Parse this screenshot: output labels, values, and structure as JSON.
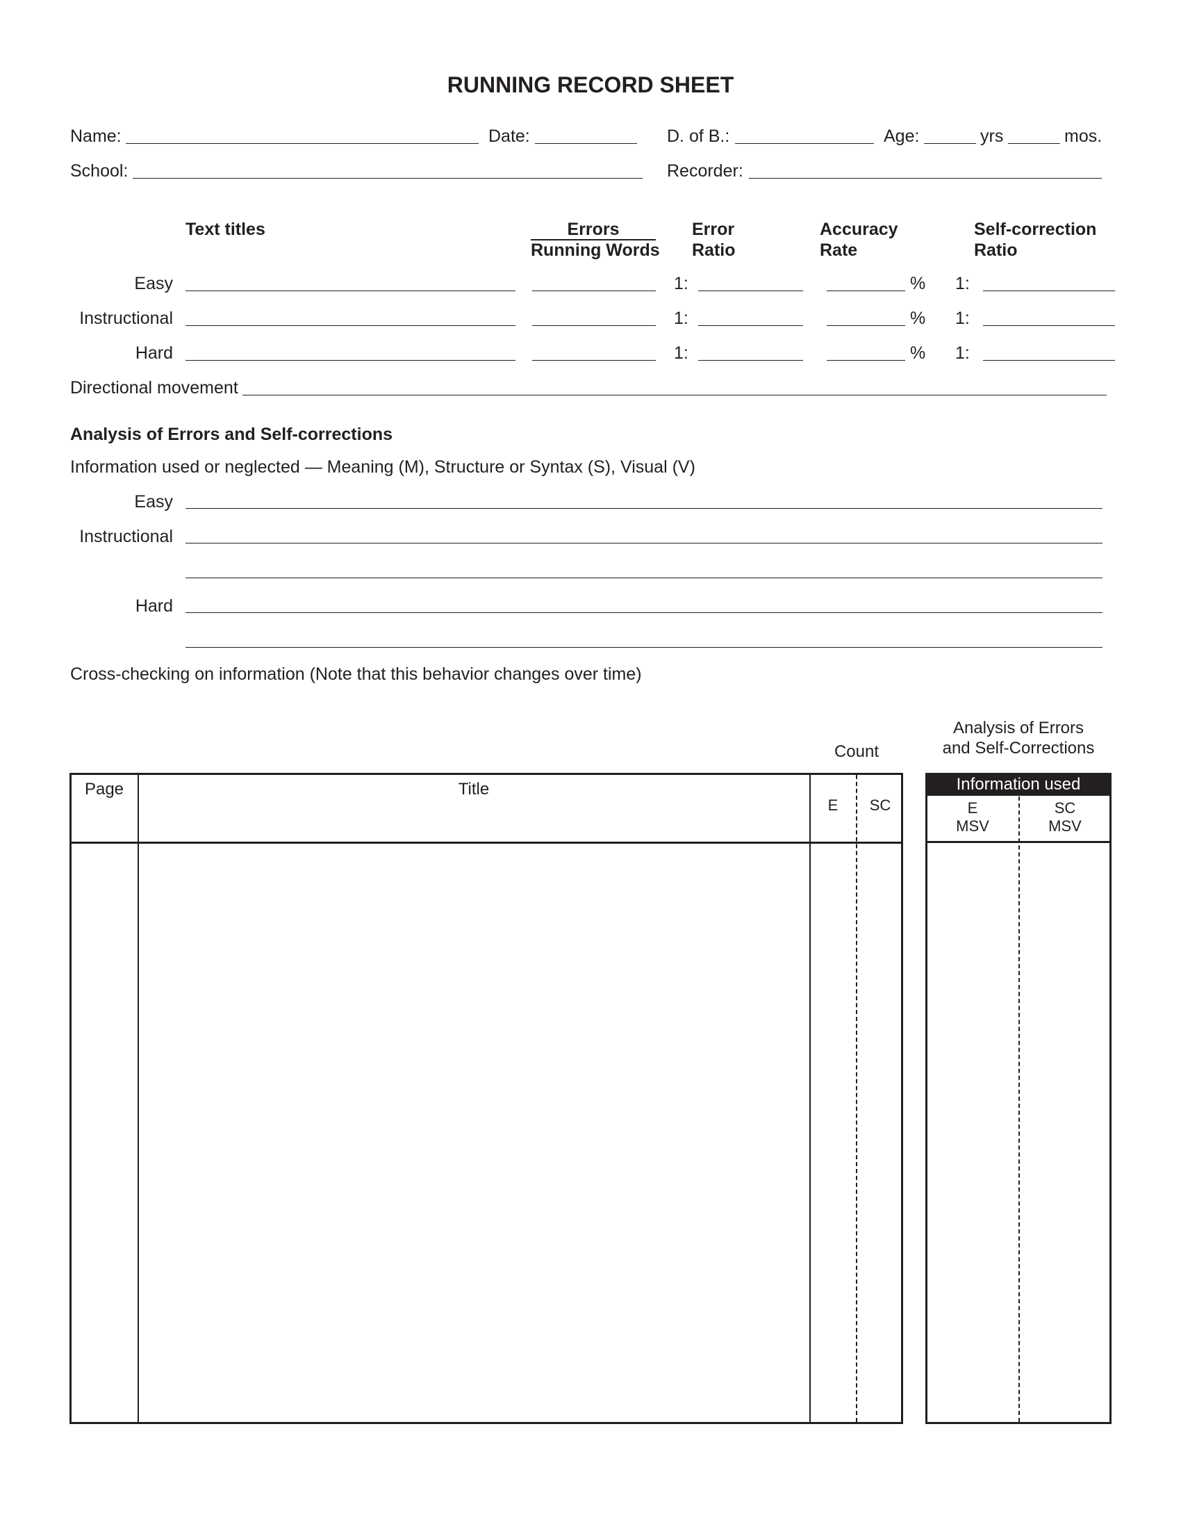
{
  "title": "RUNNING RECORD SHEET",
  "header": {
    "name_label": "Name:",
    "date_label": "Date:",
    "dob_label": "D. of B.:",
    "age_label": "Age:",
    "yrs_label": "yrs",
    "mos_label": "mos.",
    "school_label": "School:",
    "recorder_label": "Recorder:",
    "name_value": "",
    "date_value": "",
    "dob_value": "",
    "age_yrs_value": "",
    "age_mos_value": "",
    "school_value": "",
    "recorder_value": ""
  },
  "summary": {
    "columns": {
      "text_titles": "Text titles",
      "errors": "Errors",
      "running_words": "Running Words",
      "error_ratio_1": "Error",
      "error_ratio_2": "Ratio",
      "accuracy_1": "Accuracy",
      "accuracy_2": "Rate",
      "sc_ratio_1": "Self-correction",
      "sc_ratio_2": "Ratio"
    },
    "ratio_prefix": "1:",
    "percent": "%",
    "rows": [
      {
        "label": "Easy"
      },
      {
        "label": "Instructional"
      },
      {
        "label": "Hard"
      }
    ],
    "directional_label": "Directional movement"
  },
  "analysis": {
    "heading": "Analysis of Errors and Self-corrections",
    "info_text": "Information used or neglected — Meaning (M), Structure or Syntax (S), Visual (V)",
    "rows": [
      {
        "label": "Easy"
      },
      {
        "label": "Instructional"
      },
      {
        "label": "Hard"
      }
    ],
    "cross_checking": "Cross-checking on information (Note that this behavior changes over time)"
  },
  "table": {
    "page_header": "Page",
    "title_header": "Title",
    "count_label": "Count",
    "count_e": "E",
    "count_sc": "SC",
    "analysis_label_1": "Analysis of Errors",
    "analysis_label_2": "and Self-Corrections",
    "info_used": "Information used",
    "e_label": "E",
    "sc_label": "SC",
    "msv_label": "MSV"
  }
}
